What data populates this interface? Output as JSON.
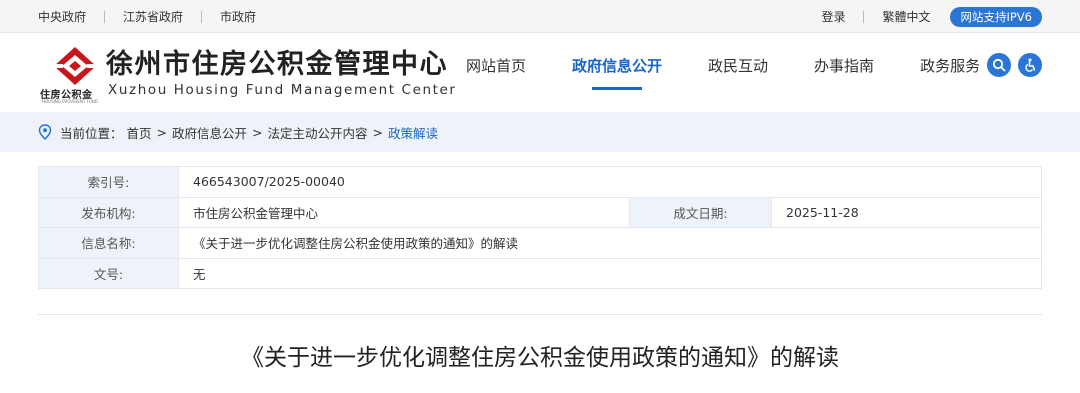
{
  "topbar": {
    "left_links": [
      "中央政府",
      "江苏省政府",
      "市政府"
    ],
    "login": "登录",
    "traditional": "繁體中文",
    "ipv6_badge": "网站支持IPV6"
  },
  "logo": {
    "name_cn": "徐州市住房公积金管理中心",
    "name_en": "Xuzhou Housing Fund Management Center",
    "badge_text": "住房公积金",
    "badge_sub": "HOUSING PROVIDENT FUND",
    "brand_color": "#c8161d"
  },
  "nav": {
    "items": [
      "网站首页",
      "政府信息公开",
      "政民互动",
      "办事指南",
      "政务服务"
    ],
    "active": "政府信息公开",
    "search_icon": "search-icon",
    "accessibility_icon": "accessibility-icon",
    "accent": "#1a66c9"
  },
  "breadcrumb": {
    "prefix": "当前位置：",
    "items": [
      "首页",
      "政府信息公开",
      "法定主动公开内容"
    ],
    "current": "政策解读",
    "icon": "location-pin-icon"
  },
  "info": {
    "index_label": "索引号:",
    "index_value": "466543007/2025-00040",
    "publisher_label": "发布机构:",
    "publisher_value": "市住房公积金管理中心",
    "date_label": "成文日期:",
    "date_value": "2025-11-28",
    "name_label": "信息名称:",
    "name_value": "《关于进一步优化调整住房公积金使用政策的通知》的解读",
    "docno_label": "文号:",
    "docno_value": "无"
  },
  "article": {
    "title": "《关于进一步优化调整住房公积金使用政策的通知》的解读"
  }
}
